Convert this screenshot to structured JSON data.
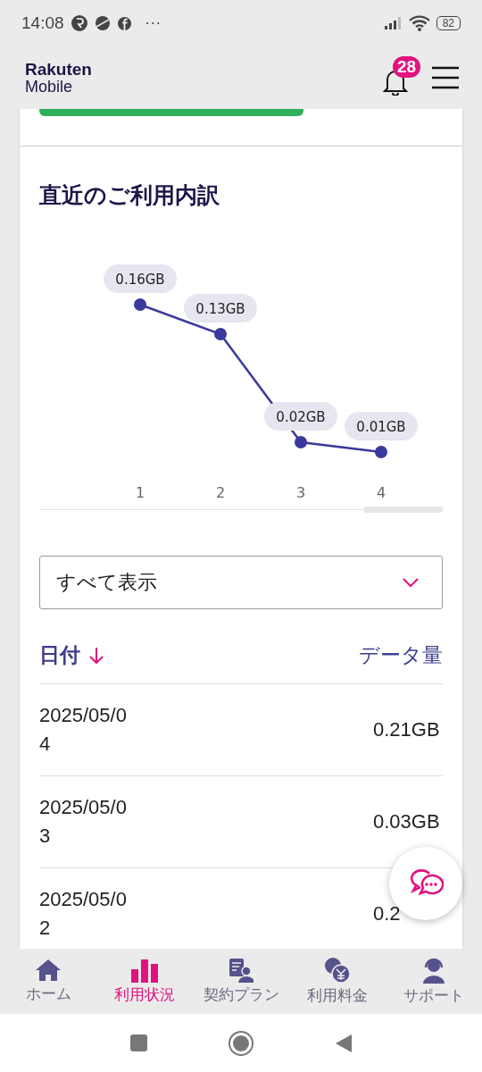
{
  "status_bar": {
    "time": "14:08",
    "more": "···",
    "battery": "82"
  },
  "header": {
    "logo_top": "Rakuten",
    "logo_bottom": "Mobile",
    "notification_count": "28"
  },
  "usage": {
    "title": "直近のご利用内訳",
    "chart_data": {
      "type": "line",
      "categories": [
        "1",
        "2",
        "3",
        "4"
      ],
      "series": [
        {
          "color": "#3a3a9c",
          "marker": true,
          "values": [
            0.16,
            0.13,
            0.02,
            0.01
          ],
          "value_labels": [
            "0.16GB",
            "0.13GB",
            "0.02GB",
            "0.01GB"
          ]
        }
      ]
    },
    "filter": {
      "value": "すべて表示"
    },
    "table": {
      "columns": [
        {
          "label": "日付",
          "sort_descending": true
        },
        {
          "label": "データ量"
        }
      ],
      "rows": [
        {
          "date": "2025/05/04",
          "amount": "0.21GB"
        },
        {
          "date": "2025/05/03",
          "amount": "0.03GB"
        },
        {
          "date": "2025/05/02",
          "amount": "0.2"
        }
      ]
    }
  },
  "bottom_nav": [
    {
      "label": "ホーム",
      "selected": false
    },
    {
      "label": "利用状況",
      "selected": true
    },
    {
      "label": "契約プラン",
      "selected": false
    },
    {
      "label": "利用料金",
      "selected": false
    },
    {
      "label": "サポート",
      "selected": false
    }
  ]
}
